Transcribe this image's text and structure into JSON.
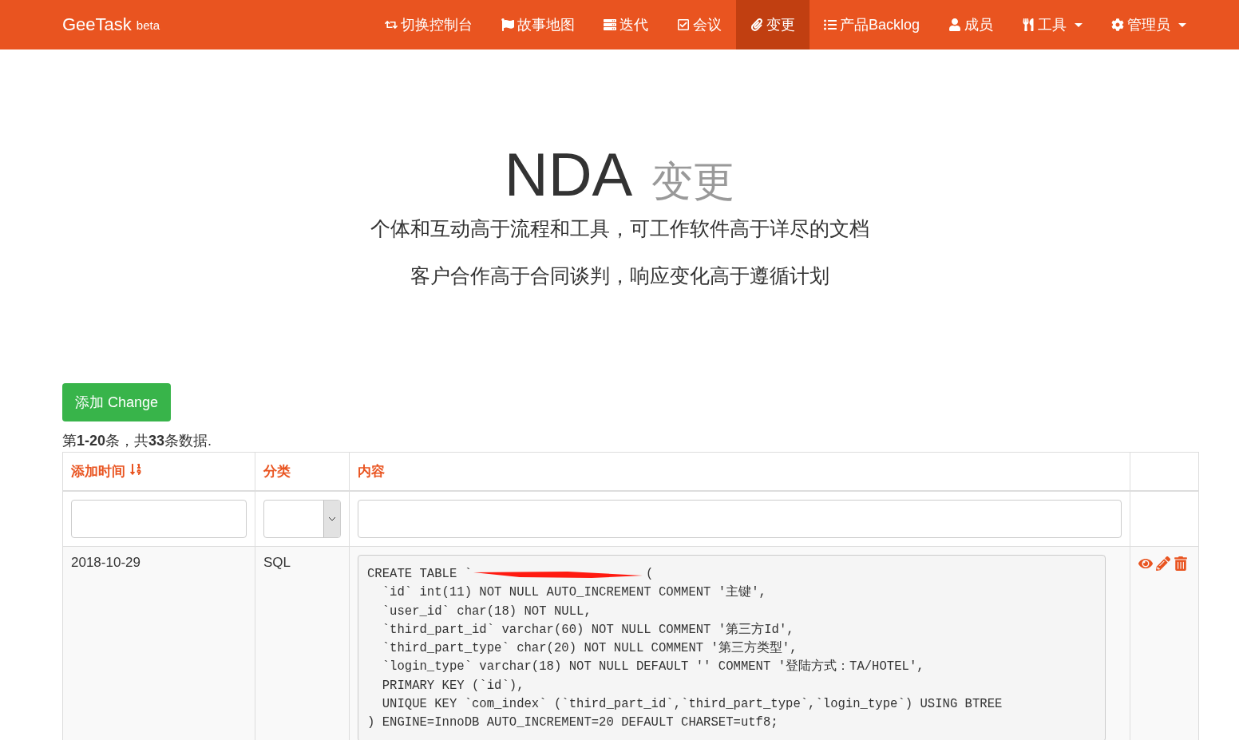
{
  "navbar": {
    "brand": "GeeTask",
    "brand_tag": "beta",
    "items": [
      {
        "kind": "switch",
        "label": "切换控制台",
        "selected": false,
        "dropdown": false
      },
      {
        "kind": "flag",
        "label": "故事地图",
        "selected": false,
        "dropdown": false
      },
      {
        "kind": "stack",
        "label": "迭代",
        "selected": false,
        "dropdown": false
      },
      {
        "kind": "check",
        "label": "会议",
        "selected": false,
        "dropdown": false
      },
      {
        "kind": "clip",
        "label": "变更",
        "selected": true,
        "dropdown": false
      },
      {
        "kind": "list",
        "label": "产品Backlog",
        "selected": false,
        "dropdown": false
      },
      {
        "kind": "user",
        "label": "成员",
        "selected": false,
        "dropdown": false
      },
      {
        "kind": "tools",
        "label": "工具",
        "selected": false,
        "dropdown": true
      },
      {
        "kind": "gear",
        "label": "管理员",
        "selected": false,
        "dropdown": true
      }
    ]
  },
  "hero": {
    "title": "NDA",
    "subtitle": "变更",
    "lines": [
      "个体和互动高于流程和工具，可工作软件高于详尽的文档",
      "客户合作高于合同谈判，响应变化高于遵循计划"
    ]
  },
  "add_button": "添加 Change",
  "summary": "第**1-20**条，共**33**条数据.",
  "table": {
    "columns": [
      {
        "label": "添加时间",
        "sorted": true
      },
      {
        "label": "分类",
        "sorted": false
      },
      {
        "label": "内容",
        "sorted": false
      }
    ],
    "rows": [
      {
        "date": "2018-10-29",
        "category": "SQL",
        "code": [
          {
            "text": "CREATE TABLE `",
            "redacted": true,
            "tail": "("
          },
          {
            "text": "  `id` int(11) NOT NULL AUTO_INCREMENT COMMENT '主键',",
            "redacted": false
          },
          {
            "text": "  `user_id` char(18) NOT NULL,",
            "redacted": false
          },
          {
            "text": "  `third_part_id` varchar(60) NOT NULL COMMENT '第三方Id',",
            "redacted": false
          },
          {
            "text": "  `third_part_type` char(20) NOT NULL COMMENT '第三方类型',",
            "redacted": false
          },
          {
            "text": "  `login_type` varchar(18) NOT NULL DEFAULT '' COMMENT '登陆方式：TA/HOTEL',",
            "redacted": false
          },
          {
            "text": "  PRIMARY KEY (`id`),",
            "redacted": false
          },
          {
            "text": "  UNIQUE KEY `com_index` (`third_part_id`,`third_part_type`,`login_type`) USING BTREE",
            "redacted": false
          },
          {
            "text": ") ENGINE=InnoDB AUTO_INCREMENT=20 DEFAULT CHARSET=utf8;",
            "redacted": false
          }
        ]
      }
    ]
  }
}
